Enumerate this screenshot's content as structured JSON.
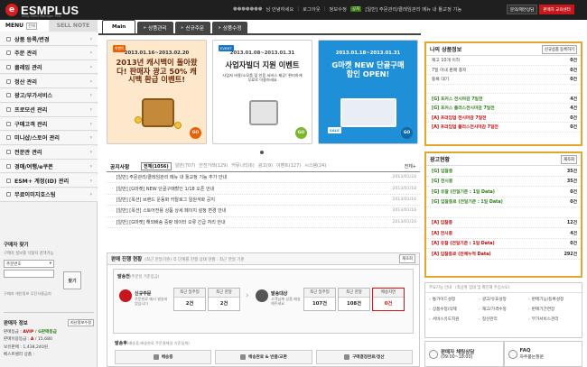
{
  "topbar": {
    "logo": "ESMPLUS",
    "logo_sub": "ebay Sales Manager Plus",
    "user_masked": "●●●●●●●",
    "greeting": "님 안녕하세요",
    "logout": "로그아웃",
    "mypage": "정보수정",
    "badge": "공지",
    "notice": "[일반] 주문관리/클레임관리 메뉴 내 툴교정 기능",
    "btn_seller_service": "판매자 교육센터",
    "btn_help": "문의/제안상담"
  },
  "sidebar": {
    "tab_menu": "MENU",
    "tab_menu_pill": "전체",
    "tab_sell_note": "SELL NOTE",
    "items": [
      {
        "label": "상품 등록/변경"
      },
      {
        "label": "주문 관리"
      },
      {
        "label": "클레임 관리"
      },
      {
        "label": "정산 관리"
      },
      {
        "label": "광고/부가서비스"
      },
      {
        "label": "프로모션 관리"
      },
      {
        "label": "구매고객 관리"
      },
      {
        "label": "미니샵/스토어 관리"
      },
      {
        "label": "전문관 관리"
      },
      {
        "label": "경매/여행/e쿠폰"
      },
      {
        "label": "ESM+ 계정(ID) 관리"
      },
      {
        "label": "무료이미지호스팅"
      }
    ],
    "search": {
      "title": "구매자 찾기",
      "desc": "구매자 정보를 낙찰자 검색가능",
      "select_value": "주문번호 ▼",
      "select_label": "주문번호",
      "button": "찾기",
      "foot": "구매자 개인정보 무단사용금지"
    },
    "seller": {
      "title": "판매자 정보",
      "title_btn": "지난정보수정",
      "lines": [
        {
          "k": "판매등급 : ",
          "a": "AVIP",
          "b": " / G판매등급"
        },
        {
          "k": "판매이용등급 : ",
          "a": "A",
          "b": "",
          "c": " / 15,680"
        },
        {
          "k": "보유판매 : ",
          "a": "",
          "b": "",
          "c": "1,438,240원"
        },
        {
          "k": "베스트셀러 상품 : ",
          "a": "",
          "b": "",
          "c": ""
        }
      ]
    }
  },
  "tabs": [
    {
      "label": "Main"
    },
    {
      "label": "상품관리"
    },
    {
      "label": "신규주문"
    },
    {
      "label": "상품수정"
    }
  ],
  "banners": [
    {
      "tag": "이벤트",
      "date": "2013.01.16~2013.02.20",
      "title": "2013년 캐시백이 돌아왔다! 판매자 광고 50% 캐시백 환급 이벤트!",
      "sub": "",
      "go": "GO"
    },
    {
      "tag": "EVENT",
      "date": "2013.01.08~2013.01.31",
      "title": "사업자빌더 지원 이벤트",
      "sub": "사업자 비용/소모품 및 인증 서비스 제공! 편리하게 무료로 이용하세요",
      "go": "GO"
    },
    {
      "tag": "",
      "date": "2013.01.18~2013.01.31",
      "title": "G마켓 NEW 단골구매합인 OPEN!",
      "sub": "SALE",
      "go": "GO"
    }
  ],
  "notice": {
    "title": "공지사항",
    "tabs": [
      {
        "label": "전체(1056)",
        "on": true
      },
      {
        "label": "일반(707)"
      },
      {
        "label": "안전거래(129)"
      },
      {
        "label": "커뮤니티(6)"
      },
      {
        "label": "광고(9)"
      },
      {
        "label": "이벤트(127)"
      },
      {
        "label": "시스템(24)"
      }
    ],
    "more": "전체+",
    "rows": [
      {
        "text": "[일반] 주문관리/클레임관리 메뉴 내 툴교정 기능 추가 안내",
        "date": "2013/01/24"
      },
      {
        "text": "[일반] [G마켓] NEW 단골구매할인 1/18 오픈 안내",
        "date": "2013/01/18"
      },
      {
        "text": "[일반] [옥션] 브랜드 운동화 카탈로그 일원석화 공지",
        "date": "2013/01/16"
      },
      {
        "text": "[일반] [옥션] 스토어전용 상품 상세 페이지 설정 변경 안내",
        "date": "2013/01/16"
      },
      {
        "text": "[일반] [G마켓] 해외배송 중량 데이터 오류 긴급 처리 안내",
        "date": "2013/01/16"
      }
    ]
  },
  "sales": {
    "title": "판매 진행 현황",
    "title_sub": "(최근 한달기준) 각 단계를 진행 상태 현황 : 최근 한달 기준",
    "refresh": "재조회",
    "section1": "발송전",
    "section1_sub": "(주문일 기준입금)",
    "new_order": "신규주문",
    "new_order_sub": "주문완료 메시 발송되었습니다",
    "cols_a": [
      {
        "h": "최근 일주일",
        "n": "2건"
      },
      {
        "h": "최근 한달",
        "n": "2건"
      }
    ],
    "ship_label": "발송대상",
    "ship_sub": "고객님께 상품 배송해주세요",
    "cols_b": [
      {
        "h": "최근 일주일",
        "n": "107건"
      },
      {
        "h": "최근 한달",
        "n": "108건"
      },
      {
        "h": "배송지연",
        "n": "0건"
      }
    ],
    "section2": "발송후",
    "section2_sub": "(배송중,배송완료 주문결제일 기준집계)",
    "stages": [
      {
        "label": "배송중"
      },
      {
        "label": "배송완료 & 반품/교환"
      },
      {
        "label": "구매결정완료/정산"
      }
    ]
  },
  "myinfo": {
    "title": "나의 상품정보",
    "btn": "신규상품 등록하기",
    "rows": [
      {
        "label": "재고 10개 이하",
        "value": "0건"
      },
      {
        "label": "7일 이내 판매 종지",
        "value": "0건"
      },
      {
        "label": "등록 대기",
        "value": "0건"
      },
      {
        "label": "",
        "value": ""
      },
      {
        "label": "[G] 포커스 전시마감 7일전",
        "value": "4건",
        "mk": "G"
      },
      {
        "label": "[G] 포커스 플러스전시마감 7일전",
        "value": "4건",
        "mk": "G"
      },
      {
        "label": "[A] 프라임업 전시마감 7일전",
        "value": "0건",
        "mk": "A"
      },
      {
        "label": "[A] 프라임업 플러스전시마감 7일전",
        "value": "0건",
        "mk": "A"
      }
    ]
  },
  "adstat": {
    "title": "광고현황",
    "btn": "재조회",
    "rows": [
      {
        "label": "[G] 입찰중",
        "value": "35건",
        "mk": "G"
      },
      {
        "label": "[G] 전시중",
        "value": "35건",
        "mk": "G"
      },
      {
        "label": "[G] 유찰 (전일기준 : 1일 Data)",
        "value": "0건",
        "mk": "G"
      },
      {
        "label": "[G] 입찰종료 (전일기준 : 1일 Data)",
        "value": "0건",
        "mk": "G"
      },
      {
        "label": "",
        "value": ""
      },
      {
        "label": "[A] 입찰중",
        "value": "12건",
        "mk": "A"
      },
      {
        "label": "[A] 전시중",
        "value": "4건",
        "mk": "A"
      },
      {
        "label": "[A] 유찰 (전일기준 : 1일 Data)",
        "value": "0건",
        "mk": "A"
      },
      {
        "label": "[A] 입찰종료 (전체누적 Data)",
        "value": "292건",
        "mk": "A"
      }
    ]
  },
  "guide": {
    "title": "주요기능 안내",
    "sub": "(최상위 업데 및 확인해 주십시오)",
    "items": [
      {
        "label": "통가이드설정"
      },
      {
        "label": "광고/유효설정"
      },
      {
        "label": "판매기능/등록설정"
      },
      {
        "label": "상품수정/삭제"
      },
      {
        "label": "재고/가격수정"
      },
      {
        "label": "판매기간연장"
      },
      {
        "label": "서비스유도지원"
      },
      {
        "label": "정산관리"
      },
      {
        "label": "부가서비스관리"
      }
    ]
  },
  "bottom": {
    "c1_title": "판매자 채팅상담",
    "c1_sub": "(09:00~18:00)",
    "c2_title": "FAQ",
    "c2_sub": "자주묻는질문"
  }
}
